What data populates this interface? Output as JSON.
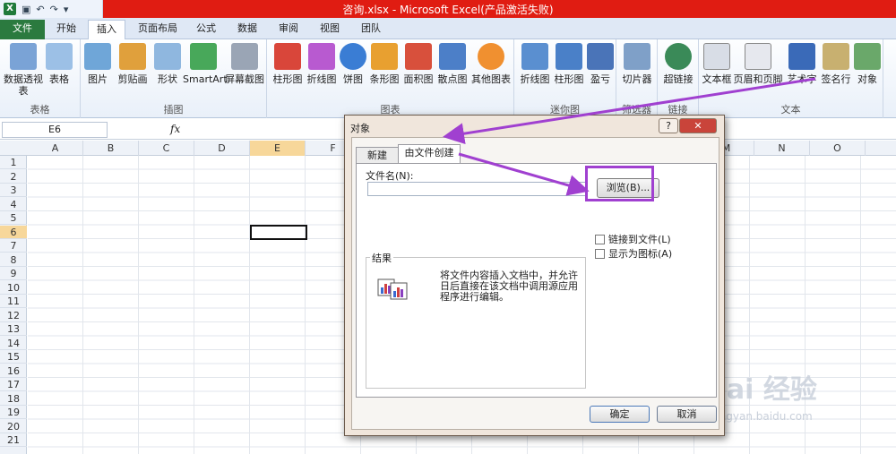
{
  "window": {
    "title": "咨询.xlsx - Microsoft Excel(产品激活失败)"
  },
  "tabs": [
    "文件",
    "开始",
    "插入",
    "页面布局",
    "公式",
    "数据",
    "审阅",
    "视图",
    "团队"
  ],
  "ribbon": {
    "groups": [
      {
        "label": "表格",
        "items": [
          "数据透视表",
          "表格"
        ]
      },
      {
        "label": "插图",
        "items": [
          "图片",
          "剪贴画",
          "形状",
          "SmartArt",
          "屏幕截图"
        ]
      },
      {
        "label": "图表",
        "items": [
          "柱形图",
          "折线图",
          "饼图",
          "条形图",
          "面积图",
          "散点图",
          "其他图表"
        ]
      },
      {
        "label": "迷你图",
        "items": [
          "折线图",
          "柱形图",
          "盈亏"
        ]
      },
      {
        "label": "筛选器",
        "items": [
          "切片器"
        ]
      },
      {
        "label": "链接",
        "items": [
          "超链接"
        ]
      },
      {
        "label": "文本",
        "items": [
          "文本框",
          "页眉和页脚",
          "艺术字",
          "签名行",
          "对象"
        ]
      }
    ]
  },
  "formula_bar": {
    "name_box": "E6",
    "fx": "fx"
  },
  "grid": {
    "columns": [
      "A",
      "B",
      "C",
      "D",
      "E",
      "F",
      "M",
      "N",
      "O"
    ],
    "rows": [
      "1",
      "2",
      "3",
      "4",
      "5",
      "6",
      "7",
      "8",
      "9",
      "10",
      "11",
      "12",
      "13",
      "14",
      "15",
      "16",
      "17",
      "18",
      "19",
      "20",
      "21"
    ]
  },
  "dialog": {
    "title": "对象",
    "help": "?",
    "close": "✕",
    "tab_new": "新建",
    "tab_from_file": "由文件创建",
    "file_name_label": "文件名(N):",
    "file_name_value": "",
    "browse": "浏览(B)...",
    "link_to_file": "链接到文件(L)",
    "display_as_icon": "显示为图标(A)",
    "result_label": "结果",
    "result_text": "将文件内容插入文档中，并允许日后直接在该文档中调用源应用程序进行编辑。",
    "ok": "确定",
    "cancel": "取消"
  },
  "watermark": {
    "main": "Bai 经验",
    "sub": "jingyan.baidu.com"
  },
  "colors": {
    "title_bar": "#e01c12",
    "file_tab": "#2b7a3f",
    "annotation": "#a040d0"
  }
}
